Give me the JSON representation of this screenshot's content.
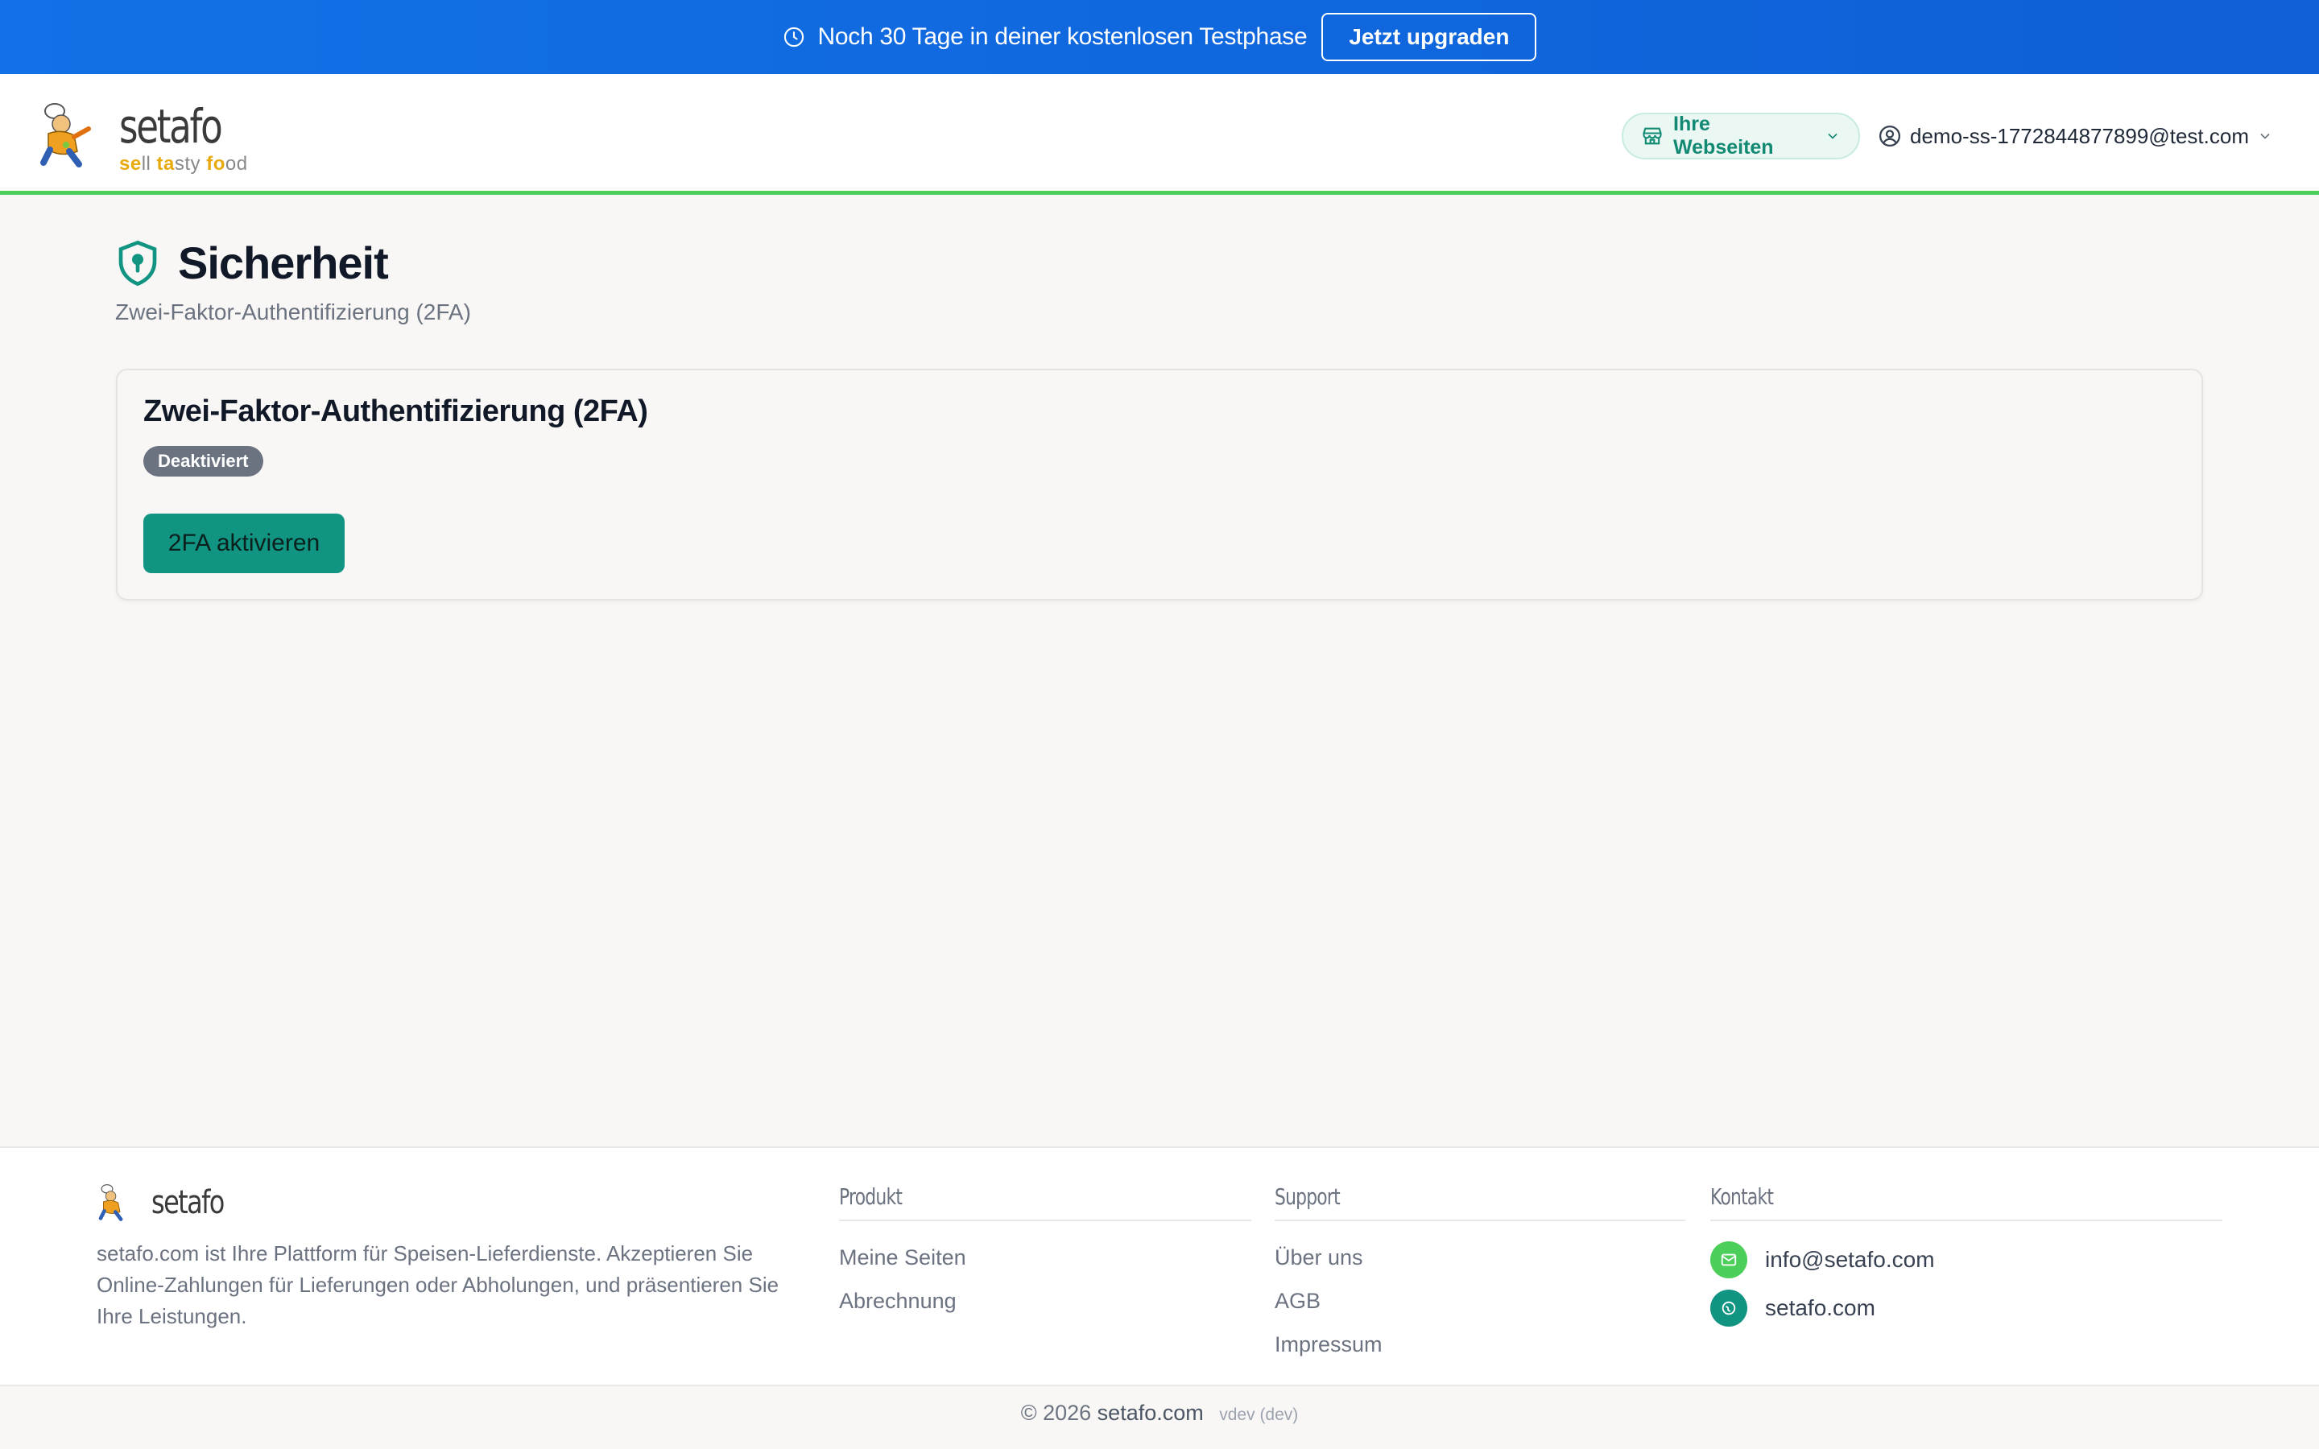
{
  "banner": {
    "message": "Noch 30 Tage in deiner kostenlosen Testphase",
    "upgrade_label": "Jetzt upgraden",
    "icon": "clock-icon"
  },
  "header": {
    "brand_name": "setafo",
    "tagline_parts": [
      "se",
      "ll ",
      "ta",
      "sty ",
      "fo",
      "od"
    ],
    "sites_label": "Ihre Webseiten",
    "user_email": "demo-ss-1772844877899@test.com"
  },
  "page": {
    "title": "Sicherheit",
    "subtitle": "Zwei-Faktor-Authentifizierung (2FA)"
  },
  "card": {
    "title": "Zwei-Faktor-Authentifizierung (2FA)",
    "status_badge": "Deaktiviert",
    "activate_label": "2FA aktivieren"
  },
  "footer": {
    "brand_name": "setafo",
    "description": "setafo.com ist Ihre Plattform für Speisen-Lieferdienste. Akzeptieren Sie Online-Zahlungen für Lieferungen oder Abholungen, und präsentieren Sie Ihre Leistungen.",
    "produkt": {
      "heading": "Produkt",
      "links": [
        "Meine Seiten",
        "Abrechnung"
      ]
    },
    "support": {
      "heading": "Support",
      "links": [
        "Über uns",
        "AGB",
        "Impressum"
      ]
    },
    "kontakt": {
      "heading": "Kontakt",
      "email": "info@setafo.com",
      "website": "setafo.com"
    },
    "copyright_prefix": "© 2026",
    "copyright_brand": "setafo.com",
    "version": "vdev (dev)"
  },
  "colors": {
    "banner": "#1271e6",
    "accent_green": "#4ccf5a",
    "primary_teal": "#119482",
    "badge_gray": "#6b7280"
  }
}
